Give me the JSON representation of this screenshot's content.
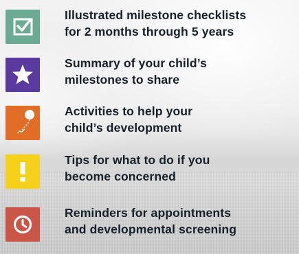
{
  "features": [
    {
      "line1": "Illustrated milestone checklists",
      "line2": "for 2 months through 5 years",
      "icon": "checkmark-icon",
      "color": "#6bab94"
    },
    {
      "line1": "Summary of your child’s",
      "line2": "milestones to share",
      "icon": "star-icon",
      "color": "#5b3aa0"
    },
    {
      "line1": "Activities to help your",
      "line2": "child’s development",
      "icon": "balloon-icon",
      "color": "#e16d26"
    },
    {
      "line1": "Tips for what to do if you",
      "line2": "become concerned",
      "icon": "exclamation-icon",
      "color": "#f6d11a"
    },
    {
      "line1": "Reminders for appointments",
      "line2": "and developmental screening",
      "icon": "clock-icon",
      "color": "#c95646"
    }
  ]
}
